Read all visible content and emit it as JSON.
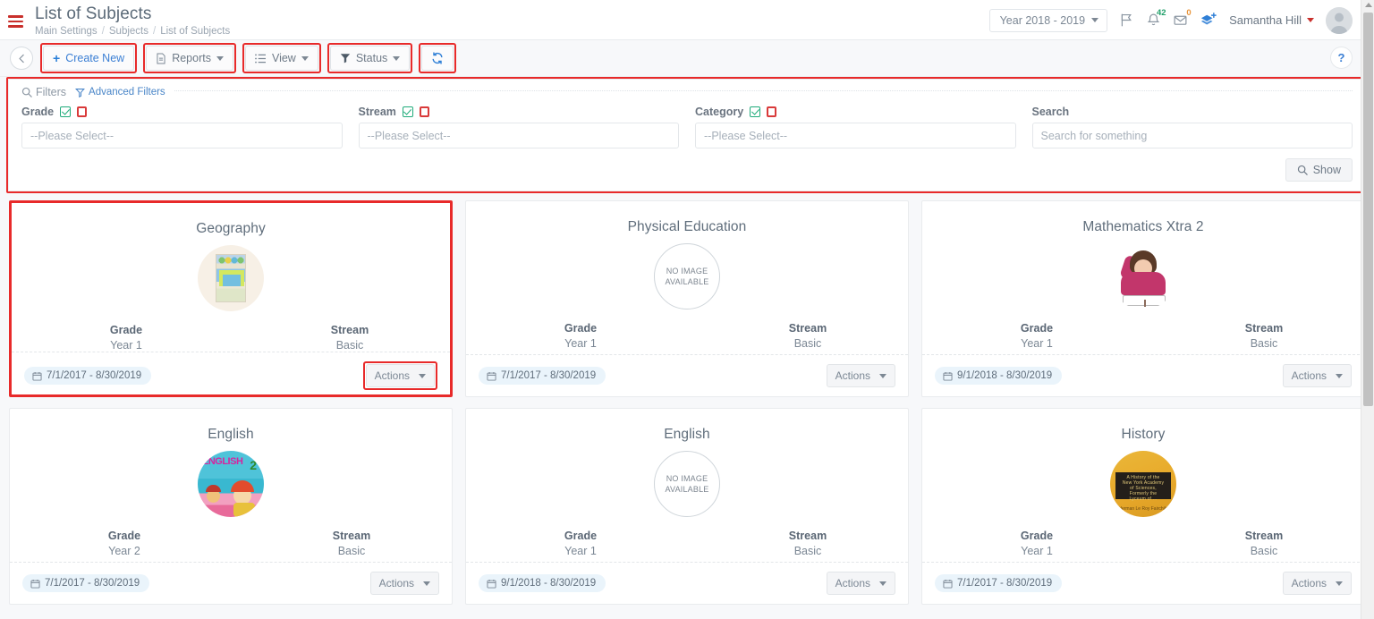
{
  "header": {
    "title": "List of Subjects",
    "breadcrumb": [
      "Main Settings",
      "Subjects",
      "List of Subjects"
    ],
    "separator": "/",
    "year_selector": "Year 2018 - 2019",
    "notifications_badge": "42",
    "messages_badge": "0",
    "user_name": "Samantha Hill"
  },
  "toolbar": {
    "back_label": "←",
    "create_new": "Create New",
    "reports": "Reports",
    "view": "View",
    "status": "Status",
    "refresh_icon": "refresh-icon",
    "help_label": "?"
  },
  "filters": {
    "panel_label": "Filters",
    "advanced_label": "Advanced Filters",
    "fields": [
      {
        "label": "Grade",
        "value": "",
        "placeholder": "--Please Select--"
      },
      {
        "label": "Stream",
        "value": "",
        "placeholder": "--Please Select--"
      },
      {
        "label": "Category",
        "value": "",
        "placeholder": "--Please Select--"
      },
      {
        "label": "Search",
        "value": "",
        "placeholder": "Search for something"
      }
    ],
    "show_label": "Show"
  },
  "cards": {
    "grade_label": "Grade",
    "stream_label": "Stream",
    "actions_label": "Actions",
    "no_image_line1": "NO IMAGE",
    "no_image_line2": "AVAILABLE",
    "items": [
      {
        "title": "Geography",
        "grade": "Year 1",
        "stream": "Basic",
        "dates": "7/1/2017 - 8/30/2019",
        "image": "geography-book-thumbnail",
        "has_image": true,
        "selected": true
      },
      {
        "title": "Physical Education",
        "grade": "Year 1",
        "stream": "Basic",
        "dates": "7/1/2017 - 8/30/2019",
        "image": "no-image-placeholder",
        "has_image": false,
        "selected": false
      },
      {
        "title": "Mathematics Xtra 2",
        "grade": "Year 1",
        "stream": "Basic",
        "dates": "9/1/2018 - 8/30/2019",
        "image": "student-reading-thumbnail",
        "has_image": true,
        "selected": false
      },
      {
        "title": "English",
        "grade": "Year 2",
        "stream": "Basic",
        "dates": "7/1/2017 - 8/30/2019",
        "image": "english-book-thumbnail",
        "has_image": true,
        "selected": false
      },
      {
        "title": "English",
        "grade": "Year 1",
        "stream": "Basic",
        "dates": "9/1/2018 - 8/30/2019",
        "image": "no-image-placeholder",
        "has_image": false,
        "selected": false
      },
      {
        "title": "History",
        "grade": "Year 1",
        "stream": "Basic",
        "dates": "7/1/2017 - 8/30/2019",
        "image": "history-book-thumbnail",
        "has_image": true,
        "selected": false
      }
    ]
  },
  "colors": {
    "highlight": "#e82a2a",
    "link": "#4a86c8",
    "accent_blue": "#3b7fd4",
    "badge_green": "#22a06b",
    "badge_orange": "#e8943a",
    "hamburger_red": "#c9302c"
  }
}
